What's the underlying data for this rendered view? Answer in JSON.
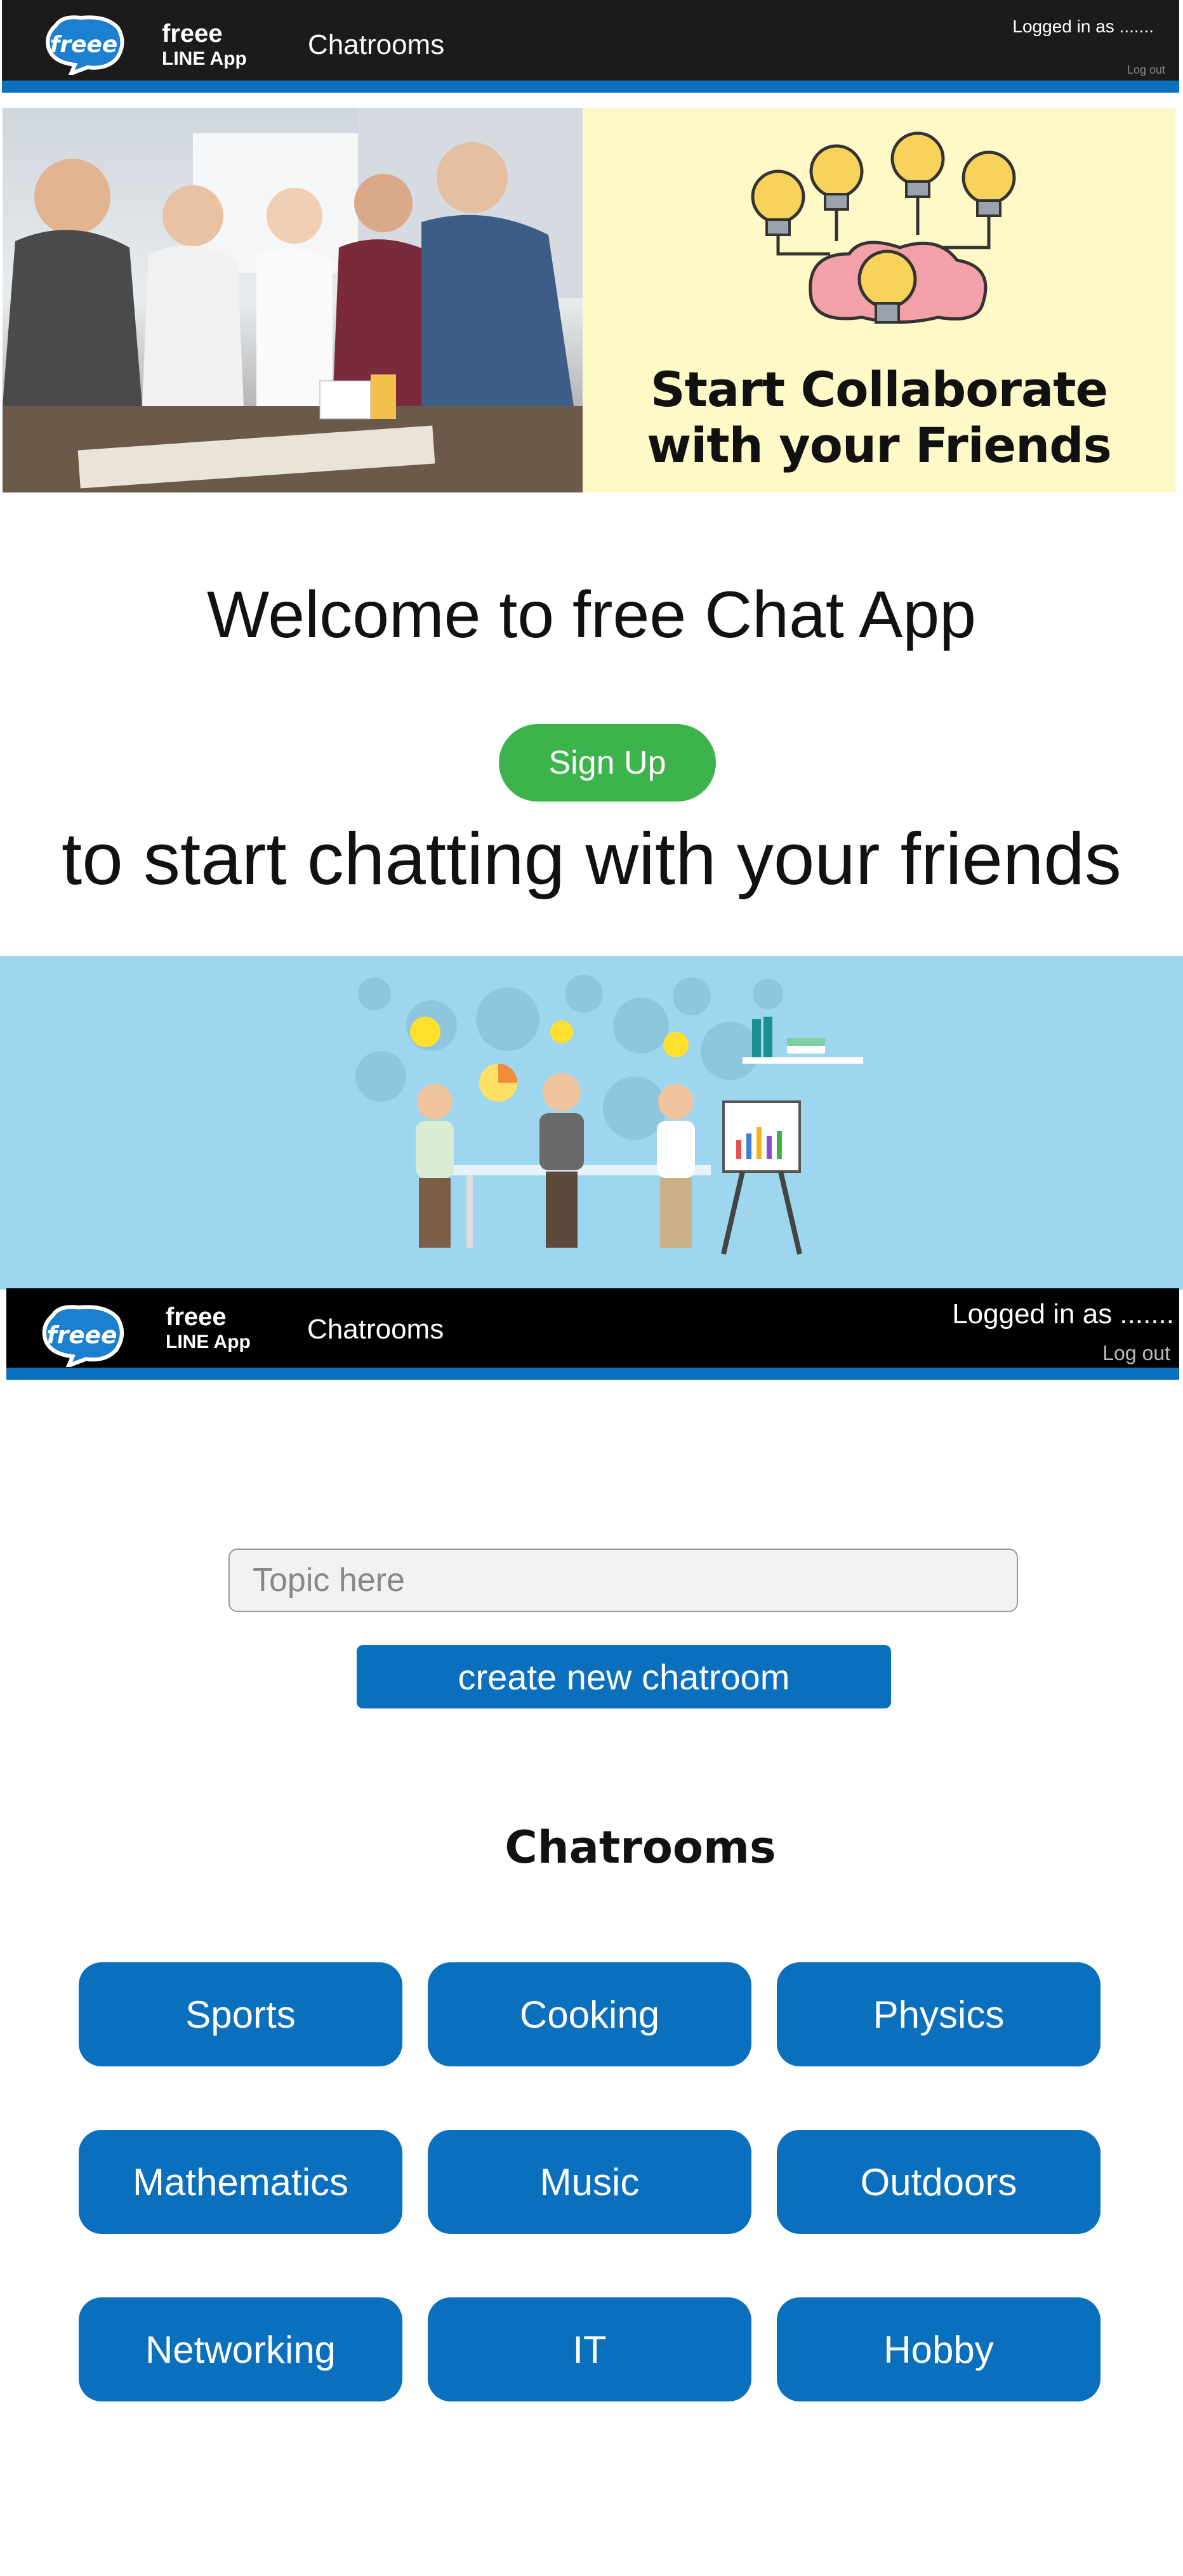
{
  "nav": {
    "brand_line1": "freee",
    "brand_line2": "LINE App",
    "chatrooms_link": "Chatrooms",
    "logged_in": "Logged in as .......",
    "logout": "Log out",
    "logo_text": "freee"
  },
  "hero": {
    "tagline_line1": "Start Collaborate",
    "tagline_line2": "with your Friends"
  },
  "welcome": {
    "title": "Welcome to free Chat App",
    "signup_label": "Sign Up",
    "subline": "to start chatting with your friends"
  },
  "create": {
    "placeholder": "Topic here",
    "button_label": "create new chatroom"
  },
  "chatrooms": {
    "heading": "Chatrooms",
    "rooms": [
      "Sports",
      "Cooking",
      "Physics",
      "Mathematics",
      "Music",
      "Outdoors",
      "Networking",
      "IT",
      "Hobby"
    ]
  },
  "colors": {
    "nav_bg": "#1b1b1b",
    "accent_blue": "#0a6fbd",
    "signup_green": "#3cb44b",
    "hero_yellow": "#fff9c8",
    "illustration_bg": "#9dd6ee"
  }
}
